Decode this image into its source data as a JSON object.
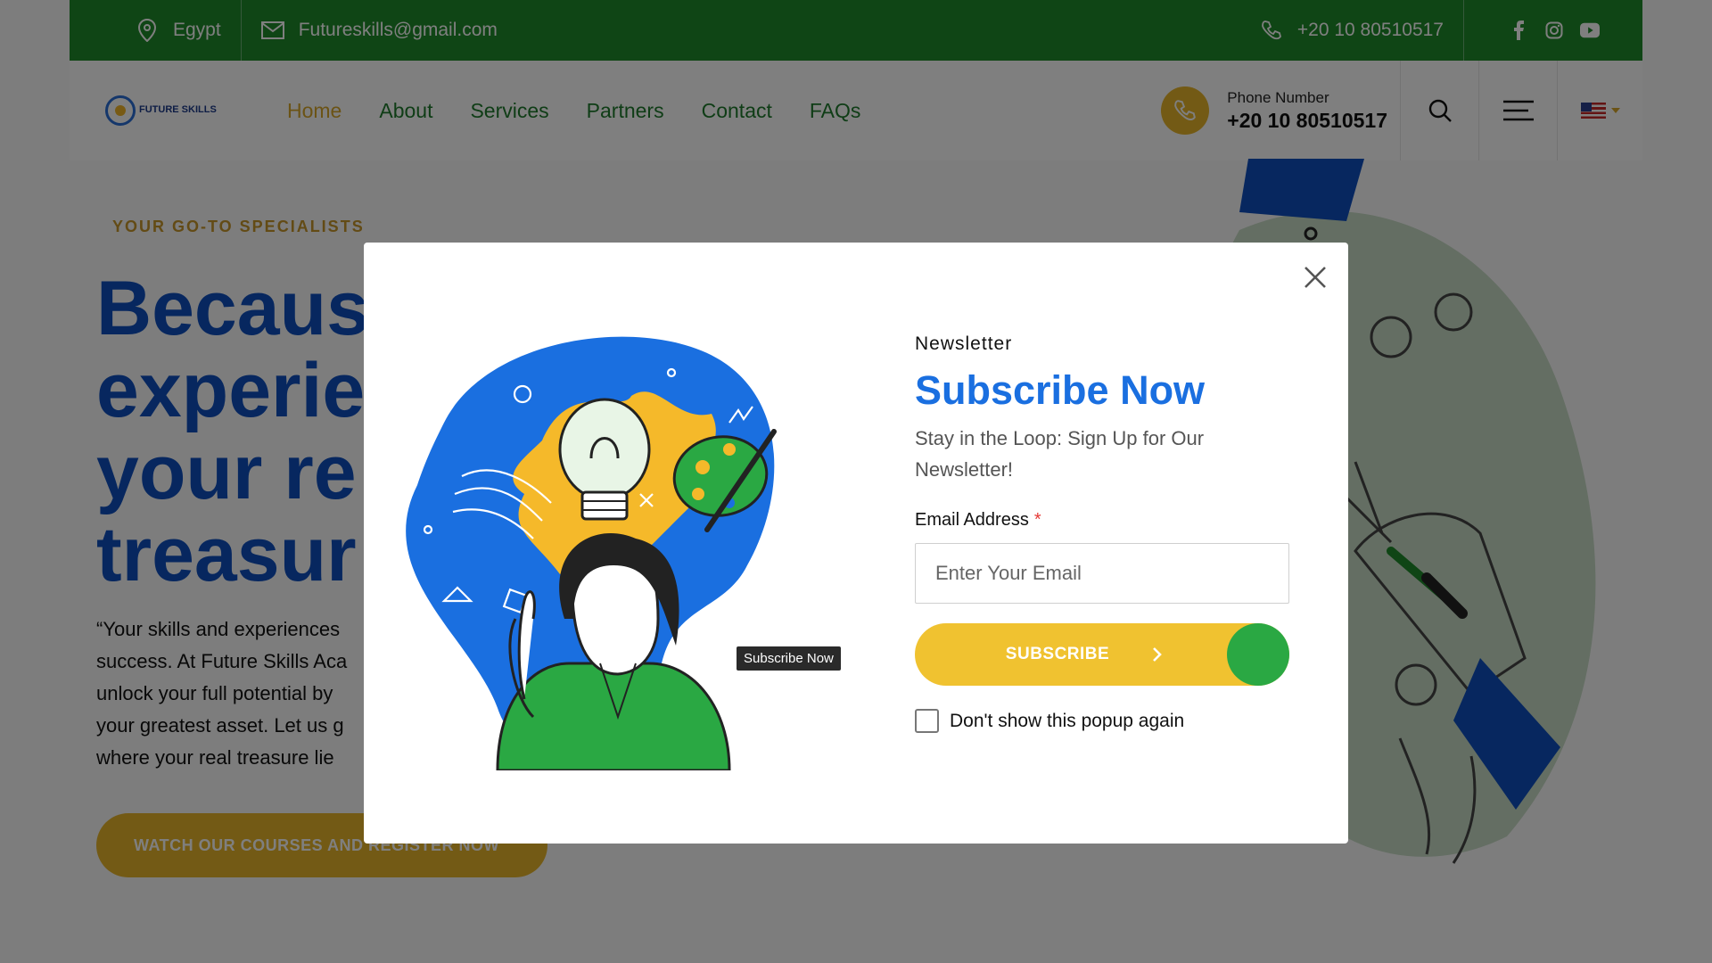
{
  "topbar": {
    "location": "Egypt",
    "email": "Futureskills@gmail.com",
    "phone": "+20 10 80510517",
    "social": [
      "facebook-icon",
      "instagram-icon",
      "youtube-icon"
    ]
  },
  "header": {
    "logo_text": "FUTURE SKILLS",
    "nav": [
      {
        "label": "Home",
        "active": true
      },
      {
        "label": "About"
      },
      {
        "label": "Services"
      },
      {
        "label": "Partners"
      },
      {
        "label": "Contact"
      },
      {
        "label": "FAQs"
      }
    ],
    "phone_label": "Phone Number",
    "phone_number": "+20 10 80510517"
  },
  "hero": {
    "kicker": "YOUR GO-TO SPECIALISTS",
    "title_lines": [
      "Becaus",
      "experie",
      "your re",
      "treasur"
    ],
    "text_lines": [
      "“Your skills and experiences",
      "success. At Future Skills Aca",
      "unlock your full potential by",
      "your greatest asset. Let us g",
      "where your real treasure lie"
    ],
    "button": "WATCH OUR COURSES AND REGISTER NOW"
  },
  "modal": {
    "kicker": "Newsletter",
    "title": "Subscribe Now",
    "subtitle": "Stay in the Loop: Sign Up for Our Newsletter!",
    "email_label": "Email Address",
    "required_mark": "*",
    "email_placeholder": "Enter Your Email",
    "subscribe_label": "SUBSCRIBE",
    "checkbox_label": "Don't show this popup again",
    "tooltip": "Subscribe Now"
  },
  "colors": {
    "brand_green": "#1f8a2a",
    "brand_blue": "#1a6fe0",
    "brand_yellow": "#f0c230"
  }
}
